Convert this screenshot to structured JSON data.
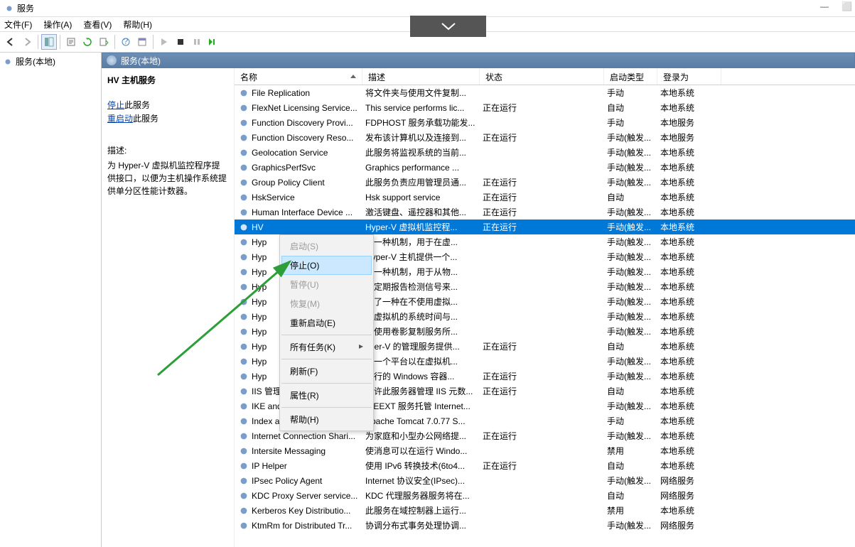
{
  "title": "服务",
  "menu": {
    "file": "文件(F)",
    "action": "操作(A)",
    "view": "查看(V)",
    "help": "帮助(H)"
  },
  "nav": {
    "root": "服务(本地)"
  },
  "caption": "服务(本地)",
  "detail": {
    "name": "HV 主机服务",
    "stop": "停止",
    "stop_suffix": "此服务",
    "restart": "重启动",
    "restart_suffix": "此服务",
    "desc_label": "描述:",
    "description": "为 Hyper-V 虚拟机监控程序提供接口，以便为主机操作系统提供单分区性能计数器。"
  },
  "columns": {
    "name": "名称",
    "desc": "描述",
    "status": "状态",
    "startup": "启动类型",
    "logon": "登录为"
  },
  "startup_vals": {
    "manual": "手动",
    "manual_trig": "手动(触发...",
    "auto": "自动",
    "disabled": "禁用"
  },
  "logon_vals": {
    "local_sys": "本地系统",
    "local_svc": "本地服务",
    "net_svc": "网络服务"
  },
  "status_vals": {
    "running": "正在运行"
  },
  "ctx": {
    "start": "启动(S)",
    "stop": "停止(O)",
    "pause": "暂停(U)",
    "resume": "恢复(M)",
    "restart": "重新启动(E)",
    "alltasks": "所有任务(K)",
    "refresh": "刷新(F)",
    "properties": "属性(R)",
    "help": "帮助(H)"
  },
  "rows": [
    {
      "name": "File Replication",
      "desc": "将文件夹与使用文件复制...",
      "status": "",
      "startup": "manual",
      "logon": "local_sys"
    },
    {
      "name": "FlexNet Licensing Service...",
      "desc": "This service performs lic...",
      "status": "running",
      "startup": "auto",
      "logon": "local_sys"
    },
    {
      "name": "Function Discovery Provi...",
      "desc": "FDPHOST 服务承载功能发...",
      "status": "",
      "startup": "manual",
      "logon": "local_svc"
    },
    {
      "name": "Function Discovery Reso...",
      "desc": "发布该计算机以及连接到...",
      "status": "running",
      "startup": "manual_trig",
      "logon": "local_svc"
    },
    {
      "name": "Geolocation Service",
      "desc": "此服务将监视系统的当前...",
      "status": "",
      "startup": "manual_trig",
      "logon": "local_sys"
    },
    {
      "name": "GraphicsPerfSvc",
      "desc": "Graphics performance ...",
      "status": "",
      "startup": "manual_trig",
      "logon": "local_sys"
    },
    {
      "name": "Group Policy Client",
      "desc": "此服务负责应用管理员通...",
      "status": "running",
      "startup": "manual_trig",
      "logon": "local_sys"
    },
    {
      "name": "HskService",
      "desc": "Hsk support service",
      "status": "running",
      "startup": "auto",
      "logon": "local_sys"
    },
    {
      "name": "Human Interface Device ...",
      "desc": "激活键盘、遥控器和其他...",
      "status": "running",
      "startup": "manual_trig",
      "logon": "local_sys"
    },
    {
      "name": "HV",
      "desc": " Hyper-V 虚拟机监控程...",
      "status": "running",
      "startup": "manual_trig",
      "logon": "local_sys",
      "selected": true
    },
    {
      "name": "Hyp",
      "desc": "供一种机制，用于在虚...",
      "status": "",
      "startup": "manual_trig",
      "logon": "local_sys"
    },
    {
      "name": "Hyp",
      "desc": " Hyper-V 主机提供一个...",
      "status": "",
      "startup": "manual_trig",
      "logon": "local_sys"
    },
    {
      "name": "Hyp",
      "desc": "供一种机制，用于从物...",
      "status": "",
      "startup": "manual_trig",
      "logon": "local_sys"
    },
    {
      "name": "Hyp",
      "desc": "过定期报告检测信号来...",
      "status": "",
      "startup": "manual_trig",
      "logon": "local_sys"
    },
    {
      "name": "Hyp",
      "desc": "供了一种在不使用虚拟...",
      "status": "",
      "startup": "manual_trig",
      "logon": "local_sys"
    },
    {
      "name": "Hyp",
      "desc": "此虚拟机的系统时间与...",
      "status": "",
      "startup": "manual_trig",
      "logon": "local_sys"
    },
    {
      "name": "Hyp",
      "desc": "调使用卷影复制服务所...",
      "status": "",
      "startup": "manual_trig",
      "logon": "local_sys"
    },
    {
      "name": "Hyp",
      "desc": "yper-V 的管理服务提供...",
      "status": "running",
      "startup": "auto",
      "logon": "local_sys"
    },
    {
      "name": "Hyp",
      "desc": "供一个平台以在虚拟机...",
      "status": "",
      "startup": "manual_trig",
      "logon": "local_sys"
    },
    {
      "name": "Hyp",
      "desc": "运行的 Windows 容器...",
      "status": "running",
      "startup": "manual_trig",
      "logon": "local_sys"
    },
    {
      "name": "IIS 管理服务",
      "desc": "允许此服务器管理 IIS 元数...",
      "status": "running",
      "startup": "auto",
      "logon": "local_sys"
    },
    {
      "name": "IKE and AuthIP IPsec Key...",
      "desc": "IKEEXT 服务托管 Internet...",
      "status": "",
      "startup": "manual_trig",
      "logon": "local_sys"
    },
    {
      "name": "Index analysis Service",
      "desc": "Apache Tomcat 7.0.77 S...",
      "status": "",
      "startup": "manual",
      "logon": "local_sys"
    },
    {
      "name": "Internet Connection Shari...",
      "desc": "为家庭和小型办公网络提...",
      "status": "running",
      "startup": "manual_trig",
      "logon": "local_sys"
    },
    {
      "name": "Intersite Messaging",
      "desc": "使消息可以在运行 Windo...",
      "status": "",
      "startup": "disabled",
      "logon": "local_sys"
    },
    {
      "name": "IP Helper",
      "desc": "使用 IPv6 转换技术(6to4...",
      "status": "running",
      "startup": "auto",
      "logon": "local_sys"
    },
    {
      "name": "IPsec Policy Agent",
      "desc": "Internet 协议安全(IPsec)...",
      "status": "",
      "startup": "manual_trig",
      "logon": "net_svc"
    },
    {
      "name": "KDC Proxy Server service...",
      "desc": "KDC 代理服务器服务将在...",
      "status": "",
      "startup": "auto",
      "logon": "net_svc"
    },
    {
      "name": "Kerberos Key Distributio...",
      "desc": "此服务在域控制器上运行...",
      "status": "",
      "startup": "disabled",
      "logon": "local_sys"
    },
    {
      "name": "KtmRm for Distributed Tr...",
      "desc": "协调分布式事务处理协调...",
      "status": "",
      "startup": "manual_trig",
      "logon": "net_svc"
    }
  ]
}
